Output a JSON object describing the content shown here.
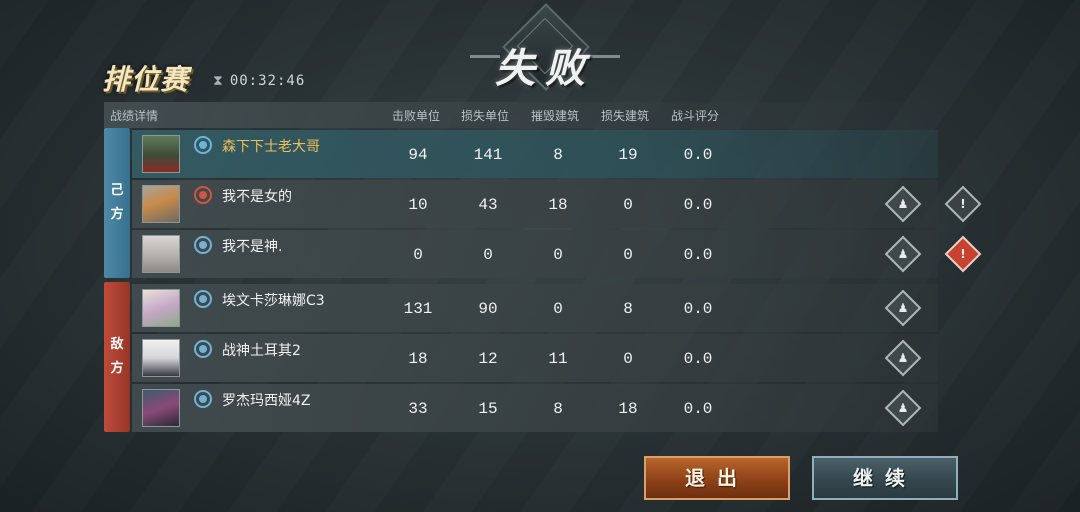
{
  "header": {
    "result_title": "失败",
    "mode": "排位赛",
    "timer": "00:32:46"
  },
  "columns": {
    "details": "战绩详情",
    "kills": "击败单位",
    "losses": "损失单位",
    "destroyed_buildings": "摧毁建筑",
    "lost_buildings": "损失建筑",
    "score": "战斗评分"
  },
  "teams": {
    "ally_label": [
      "己",
      "方"
    ],
    "enemy_label": [
      "敌",
      "方"
    ]
  },
  "ally_players": [
    {
      "name": "森下下士老大哥",
      "kills": "94",
      "losses": "141",
      "destroyed": "8",
      "lost": "19",
      "score": "0.0",
      "rank_icon": "blue-rank-icon"
    },
    {
      "name": "我不是女的",
      "kills": "10",
      "losses": "43",
      "destroyed": "18",
      "lost": "0",
      "score": "0.0",
      "rank_icon": "red-rank-icon"
    },
    {
      "name": "我不是神.",
      "kills": "0",
      "losses": "0",
      "destroyed": "0",
      "lost": "0",
      "score": "0.0",
      "rank_icon": "blue-rank-icon"
    }
  ],
  "enemy_players": [
    {
      "name": "埃文卡莎琳娜C3",
      "kills": "131",
      "losses": "90",
      "destroyed": "0",
      "lost": "8",
      "score": "0.0",
      "rank_icon": "blue-rank-icon"
    },
    {
      "name": "战神土耳其2",
      "kills": "18",
      "losses": "12",
      "destroyed": "11",
      "lost": "0",
      "score": "0.0",
      "rank_icon": "blue-rank-icon"
    },
    {
      "name": "罗杰玛西娅4Z",
      "kills": "33",
      "losses": "15",
      "destroyed": "8",
      "lost": "18",
      "score": "0.0",
      "rank_icon": "blue-rank-icon"
    }
  ],
  "buttons": {
    "exit": "退出",
    "continue": "继续"
  },
  "colors": {
    "self_name": "#f0c05a",
    "ally": "#4e8aa8",
    "enemy": "#c04a3a",
    "exit_button": "#b9652c"
  }
}
